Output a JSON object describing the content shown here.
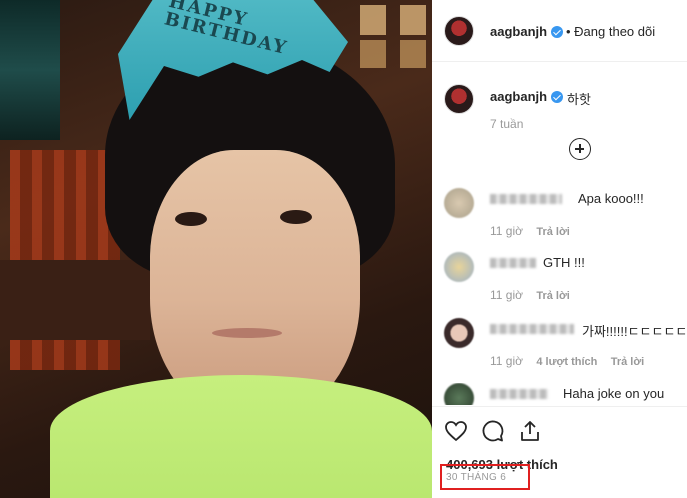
{
  "post": {
    "username": "aagbanjh",
    "follow_status": "• Đang theo dõi",
    "caption": "하핫",
    "caption_time": "7 tuần",
    "hat_text": "HAPPY BIRTHDAY"
  },
  "comments": [
    {
      "text": "Apa kooo!!!",
      "time": "11 giờ",
      "likes": "",
      "reply": "Trả lời"
    },
    {
      "text": "GTH !!!",
      "time": "11 giờ",
      "likes": "",
      "reply": "Trả lời"
    },
    {
      "text": "가짜!!!!!!ㄷㄷㄷㄷㄷ",
      "time": "11 giờ",
      "likes": "4 lượt thích",
      "reply": "Trả lời"
    },
    {
      "text": "Haha joke on you",
      "time": "",
      "likes": "",
      "reply": ""
    }
  ],
  "actions": {
    "like_icon": "heart-icon",
    "comment_icon": "comment-icon",
    "share_icon": "share-icon"
  },
  "likes_count": "400,693 lượt thích",
  "post_date": "30 THÁNG 6",
  "colors": {
    "verified": "#3897f0",
    "highlight_box": "#e02020",
    "muted": "#999999"
  }
}
